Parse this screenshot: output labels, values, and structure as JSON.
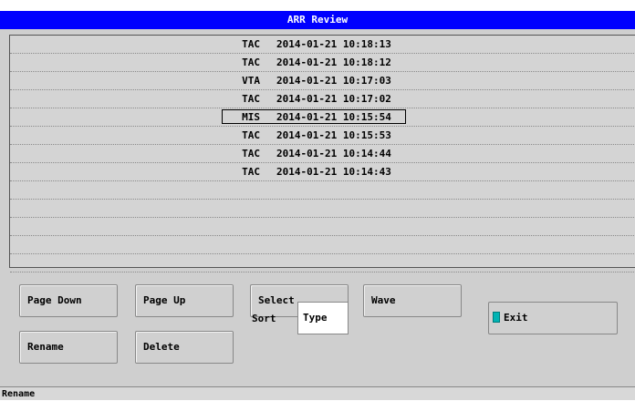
{
  "window": {
    "title": "ARR Review"
  },
  "events": [
    {
      "type": "TAC",
      "datetime": "2014-01-21 10:18:13"
    },
    {
      "type": "TAC",
      "datetime": "2014-01-21 10:18:12"
    },
    {
      "type": "VTA",
      "datetime": "2014-01-21 10:17:03"
    },
    {
      "type": "TAC",
      "datetime": "2014-01-21 10:17:02"
    },
    {
      "type": "MIS",
      "datetime": "2014-01-21 10:15:54",
      "selected": true
    },
    {
      "type": "TAC",
      "datetime": "2014-01-21 10:15:53"
    },
    {
      "type": "TAC",
      "datetime": "2014-01-21 10:14:44"
    },
    {
      "type": "TAC",
      "datetime": "2014-01-21 10:14:43"
    }
  ],
  "buttons": {
    "page_down": "Page Down",
    "page_up": "Page Up",
    "select": "Select",
    "wave": "Wave",
    "rename": "Rename",
    "delete": "Delete",
    "exit": "Exit"
  },
  "sort": {
    "label": "Sort",
    "value": "Type"
  },
  "status": {
    "text": "Rename"
  },
  "colors": {
    "titlebar": "#0000ff",
    "panel": "#cfcfcf",
    "exit_icon": "#00b3b3"
  }
}
